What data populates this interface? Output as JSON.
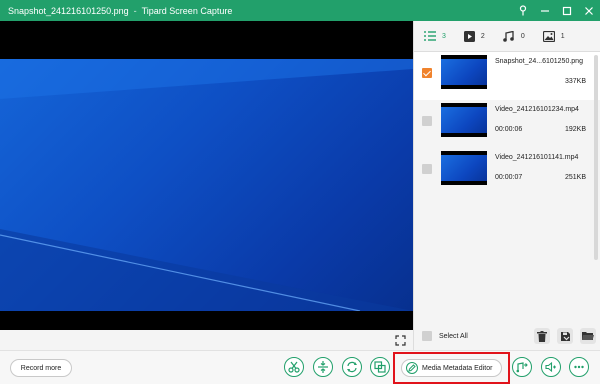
{
  "window": {
    "filename": "Snapshot_241216101250.png",
    "separator": "-",
    "app_name": "Tipard Screen Capture"
  },
  "tabs": [
    {
      "icon": "list-icon",
      "count": "3"
    },
    {
      "icon": "video-icon",
      "count": "2"
    },
    {
      "icon": "audio-icon",
      "count": "0"
    },
    {
      "icon": "image-icon",
      "count": "1"
    }
  ],
  "files": [
    {
      "name": "Snapshot_24...6101250.png",
      "duration": "",
      "size": "337KB",
      "selected": true
    },
    {
      "name": "Video_241216101234.mp4",
      "duration": "00:00:06",
      "size": "192KB",
      "selected": false
    },
    {
      "name": "Video_241216101141.mp4",
      "duration": "00:00:07",
      "size": "251KB",
      "selected": false
    }
  ],
  "select_all_label": "Select All",
  "bottombar": {
    "record_more": "Record more",
    "media_metadata_editor": "Media Metadata Editor"
  },
  "colors": {
    "accent": "#22a06b",
    "highlight": "#e1131b",
    "check": "#f0832d"
  }
}
